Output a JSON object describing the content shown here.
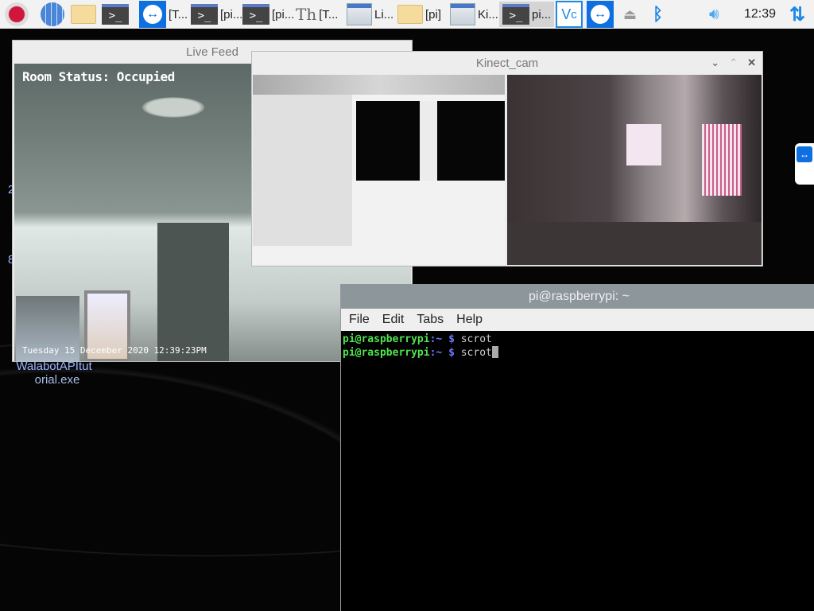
{
  "taskbar": {
    "items": [
      {
        "icon": "raspberry-icon",
        "label": ""
      },
      {
        "icon": "globe-icon",
        "label": ""
      },
      {
        "icon": "folder-icon",
        "label": ""
      },
      {
        "icon": "terminal-icon",
        "label": ""
      },
      {
        "icon": "teamviewer-icon",
        "label": "[T..."
      },
      {
        "icon": "terminal-icon",
        "label": "[pi..."
      },
      {
        "icon": "terminal-icon",
        "label": "[pi..."
      },
      {
        "icon": "font-icon",
        "label": "[T..."
      },
      {
        "icon": "window-icon",
        "label": "Li..."
      },
      {
        "icon": "folder-icon",
        "label": "[pi]"
      },
      {
        "icon": "window-icon",
        "label": "Ki..."
      },
      {
        "icon": "terminal-icon",
        "label": "pi..."
      }
    ],
    "tray": {
      "clock": "12:39",
      "icons": [
        "vnc-icon",
        "teamviewer-icon",
        "eject-icon",
        "bluetooth-icon",
        "volume-icon",
        "network-icon"
      ]
    }
  },
  "desktop": {
    "icon_label_line1": "WalabotAPItut",
    "icon_label_line2": "orial.exe",
    "partial_1": "2",
    "partial_2": "8"
  },
  "live_feed": {
    "title": "Live Feed",
    "status_overlay": "Room Status: Occupied",
    "timestamp_overlay": "Tuesday 15 December 2020 12:39:23PM"
  },
  "kinect": {
    "title": "Kinect_cam"
  },
  "terminal": {
    "title": "pi@raspberrypi: ~",
    "menu": [
      "File",
      "Edit",
      "Tabs",
      "Help"
    ],
    "lines": [
      {
        "user": "pi@raspberrypi",
        "path": ":~",
        "prompt": "$",
        "cmd": "scrot"
      },
      {
        "user": "pi@raspberrypi",
        "path": ":~",
        "prompt": "$",
        "cmd": "scrot"
      }
    ]
  },
  "colors": {
    "accent": "#0e6fe0",
    "prompt_user": "#4ee44e",
    "prompt_dollar": "#6b7bff"
  }
}
